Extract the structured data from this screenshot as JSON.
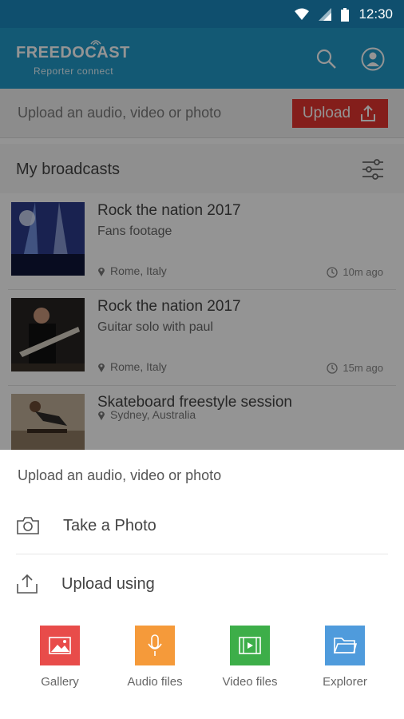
{
  "status_bar": {
    "time": "12:30"
  },
  "app": {
    "logo_main": "FREEDOCAST",
    "logo_sub": "Reporter connect"
  },
  "upload_strip": {
    "text": "Upload an audio, video or photo",
    "button_label": "Upload"
  },
  "broadcasts": {
    "title": "My broadcasts",
    "items": [
      {
        "title": "Rock the nation 2017",
        "subtitle": "Fans footage",
        "location": "Rome, Italy",
        "time": "10m ago"
      },
      {
        "title": "Rock the nation 2017",
        "subtitle": "Guitar solo with paul",
        "location": "Rome, Italy",
        "time": "15m ago"
      },
      {
        "title": "Skateboard freestyle session",
        "subtitle": "",
        "location": "Sydney, Australia",
        "time": ""
      }
    ]
  },
  "sheet": {
    "title": "Upload an audio, video or photo",
    "take_photo": "Take a Photo",
    "upload_using": "Upload using",
    "tiles": [
      {
        "label": "Gallery",
        "color": "#e84c4a",
        "icon": "gallery-icon"
      },
      {
        "label": "Audio files",
        "color": "#f59a3a",
        "icon": "microphone-icon"
      },
      {
        "label": "Video files",
        "color": "#3dae49",
        "icon": "film-icon"
      },
      {
        "label": "Explorer",
        "color": "#4f9bdc",
        "icon": "folder-icon"
      }
    ]
  },
  "colors": {
    "status_bar": "#0f4f6e",
    "app_bar": "#2199c9",
    "upload_button": "#e3342f"
  }
}
